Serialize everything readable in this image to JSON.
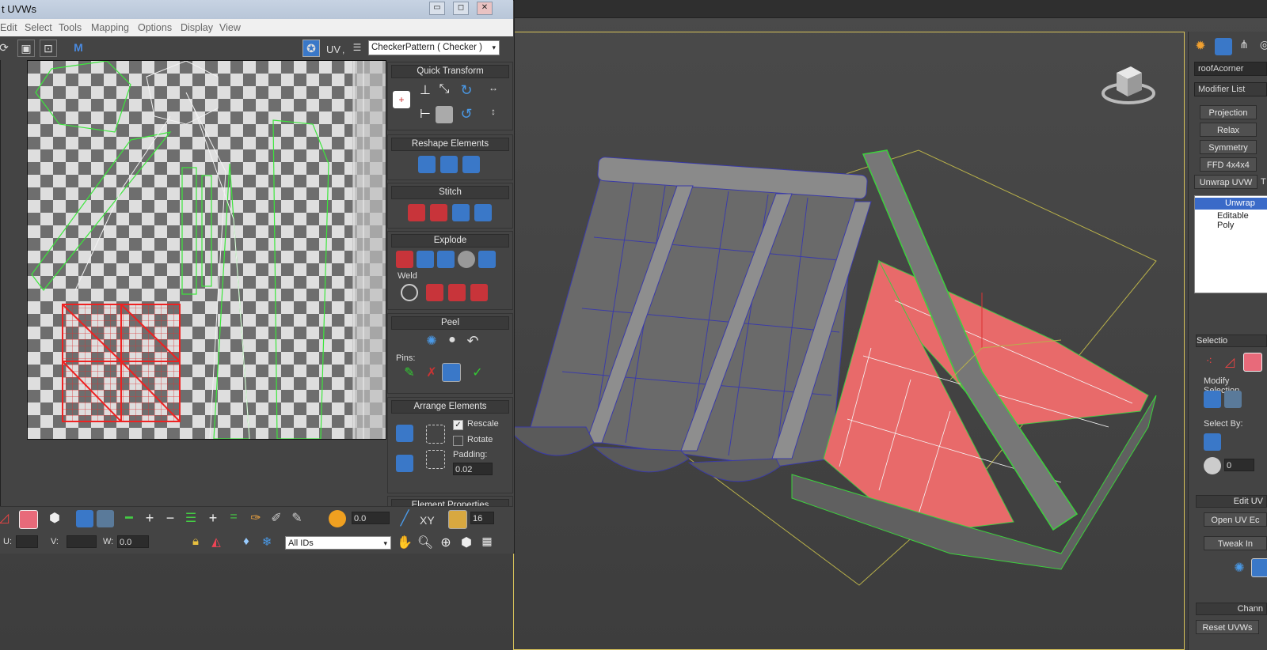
{
  "window": {
    "title": "t UVWs",
    "controls": {
      "minimize": "▭",
      "restore": "◻",
      "close": "✕"
    }
  },
  "menu": [
    "Edit",
    "Select",
    "Tools",
    "Mapping",
    "Options",
    "Display",
    "View"
  ],
  "toolbar": {
    "uv_label": "UV",
    "uv_suffix": ",",
    "map_select": "CheckerPattern  ( Checker )"
  },
  "panels": {
    "quick_transform": "Quick Transform",
    "reshape": "Reshape Elements",
    "stitch": "Stitch",
    "explode": "Explode",
    "weld": "Weld",
    "peel": "Peel",
    "pins": "Pins:",
    "arrange": "Arrange Elements",
    "rescale": "Rescale",
    "rotate": "Rotate",
    "padding_label": "Padding:",
    "padding_value": "0.02",
    "element_props": "Element Properties"
  },
  "bottom": {
    "spinner_value": "0.0",
    "xy_label": "XY",
    "grid_value": "16",
    "u_label": "U:",
    "v_label": "V:",
    "w_label": "W:",
    "w_value": "0.0",
    "id_select": "All IDs"
  },
  "command_panel": {
    "object_name": "roofAcorner",
    "modifier_list": "Modifier List",
    "buttons": [
      "Projection",
      "Relax",
      "Symmetry",
      "FFD 4x4x4",
      "Unwrap UVW"
    ],
    "stack": [
      "Unwrap UV",
      "Editable Poly"
    ],
    "t_label": "T",
    "selection_header": "Selectio",
    "modify_selection": "Modify Selection",
    "select_by": "Select By:",
    "select_by_value": "0",
    "edit_uv_header": "Edit UV",
    "open_uv_editor": "Open UV Ec",
    "tweak": "Tweak In",
    "channel_header": "Chann",
    "reset_uvws": "Reset UVWs"
  }
}
